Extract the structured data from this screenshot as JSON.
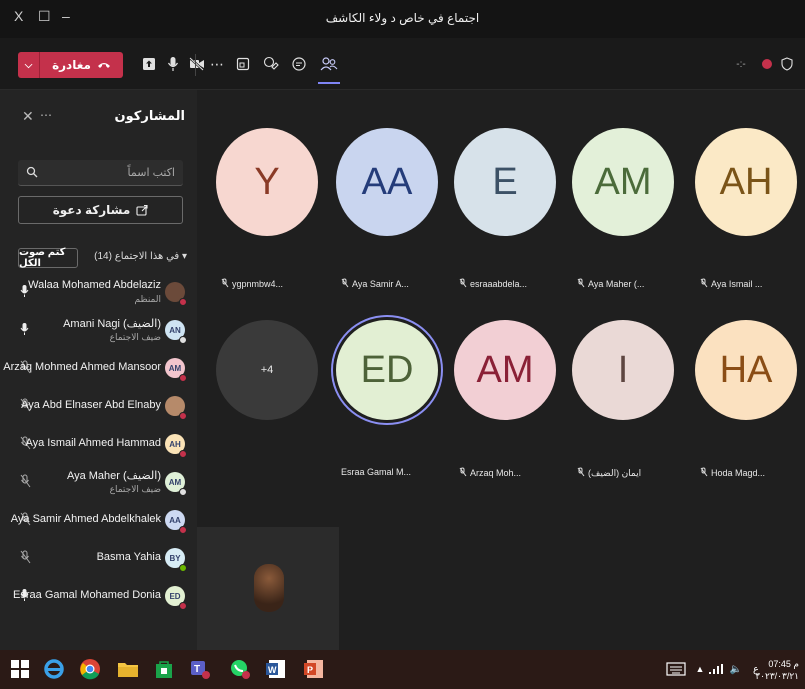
{
  "window": {
    "title": "اجتماع في خاص د ولاء الكاشف",
    "close_glyph": "X",
    "restore_glyph": "☐",
    "min_glyph": "–"
  },
  "toolbar": {
    "leave_label": "مغادرة"
  },
  "sidebar": {
    "title": "المشاركون",
    "search_placeholder": "اكتب اسماً",
    "share_label": "مشاركة دعوة",
    "section_label": "في هذا الاجتماع (14)",
    "mute_all_label": "كتم صوت الكل",
    "participants": [
      {
        "name": "Walaa Mohamed Abdelaziz",
        "sub": "المنظم",
        "avatar": "",
        "av_bg": "#6b4a3a",
        "mic": "on",
        "status": "#c4314b"
      },
      {
        "name": "Amani Nagi (الضيف)",
        "sub": "ضيف الاجتماع",
        "avatar": "AN",
        "av_bg": "#cfe4f3",
        "mic": "on",
        "status": "#e0e0e0"
      },
      {
        "name": "Arzaq Mohmed Ahmed Mansoor",
        "sub": "",
        "avatar": "AM",
        "av_bg": "#f2c5cd",
        "mic": "off",
        "status": "#c4314b"
      },
      {
        "name": "Aya Abd Elnaser Abd Elnaby",
        "sub": "",
        "avatar": "",
        "av_bg": "#b68a6a",
        "mic": "off",
        "status": "#c4314b"
      },
      {
        "name": "Aya Ismail Ahmed Hammad",
        "sub": "",
        "avatar": "AH",
        "av_bg": "#fbe3b7",
        "mic": "off",
        "status": "#c4314b"
      },
      {
        "name": "Aya Maher (الضيف)",
        "sub": "ضيف الاجتماع",
        "avatar": "AM",
        "av_bg": "#dff0d8",
        "mic": "off",
        "status": "#e0e0e0"
      },
      {
        "name": "Aya Samir Ahmed Abdelkhalek",
        "sub": "",
        "avatar": "AA",
        "av_bg": "#cdd9f2",
        "mic": "off",
        "status": "#c4314b"
      },
      {
        "name": "Basma Yahia",
        "sub": "",
        "avatar": "BY",
        "av_bg": "#d7ecf5",
        "mic": "off",
        "status": "#6bb700"
      },
      {
        "name": "Esraa Gamal Mohamed Donia",
        "sub": "",
        "avatar": "ED",
        "av_bg": "#e2f0d2",
        "mic": "on",
        "status": "#c4314b"
      }
    ]
  },
  "stage": {
    "tiles": [
      {
        "initials": "AH",
        "label": "Aya Ismail ...",
        "bg": "#fbe9c6",
        "fg": "#7a5418",
        "muted": true
      },
      {
        "initials": "AM",
        "label": "Aya Maher (...",
        "bg": "#e3f0d9",
        "fg": "#4b6b3a",
        "muted": true
      },
      {
        "initials": "E",
        "label": "esraaabdela...",
        "bg": "#d7e2ea",
        "fg": "#3c5166",
        "muted": true
      },
      {
        "initials": "AA",
        "label": "Aya Samir A...",
        "bg": "#c9d5ef",
        "fg": "#243c7a",
        "muted": true
      },
      {
        "initials": "Y",
        "label": "ygpnmbw4...",
        "bg": "#f7d7d0",
        "fg": "#8a3a26",
        "muted": true
      },
      {
        "initials": "HA",
        "label": "Hoda Magd...",
        "bg": "#fbe1c0",
        "fg": "#8a4d16",
        "muted": true
      },
      {
        "initials": "I",
        "label": "ايمان (الضيف)",
        "bg": "#ead9d6",
        "fg": "#5e4641",
        "muted": true
      },
      {
        "initials": "AM",
        "label": "Arzaq Moh...",
        "bg": "#f2cfd4",
        "fg": "#8a2036",
        "muted": true
      },
      {
        "initials": "ED",
        "label": "Esraa Gamal M...",
        "bg": "#e2efd3",
        "fg": "#4d6238",
        "muted": false
      },
      {
        "initials": "+4",
        "label": "",
        "bg": "#3a3a3a",
        "fg": "#e8e8e8",
        "muted": false
      }
    ]
  },
  "taskbar": {
    "time": "07:45 م",
    "date": "٢٠٢٣/٠٣/٢١",
    "lang": "ع"
  }
}
